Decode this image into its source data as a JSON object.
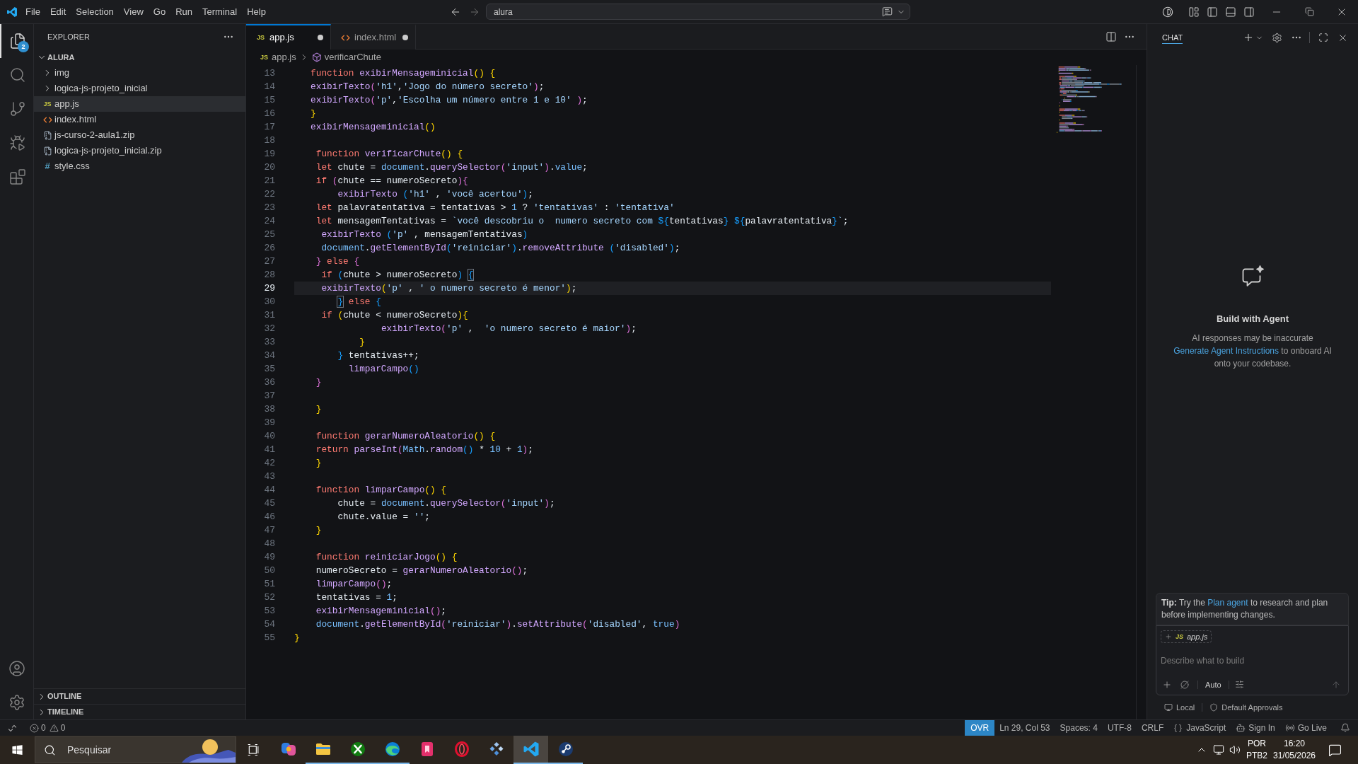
{
  "title_bar": {
    "menu": [
      "File",
      "Edit",
      "Selection",
      "View",
      "Go",
      "Run",
      "Terminal",
      "Help"
    ],
    "command_center": {
      "value": "alura"
    }
  },
  "activity_bar": {
    "items": [
      {
        "kind": "explorer",
        "selected": true,
        "badge": "2"
      },
      {
        "kind": "search",
        "selected": false
      },
      {
        "kind": "source_control",
        "selected": false
      },
      {
        "kind": "run",
        "selected": false
      },
      {
        "kind": "extensions",
        "selected": false
      }
    ],
    "bottom_items": [
      {
        "kind": "accounts"
      },
      {
        "kind": "manage"
      }
    ]
  },
  "explorer": {
    "title": "EXPLORER",
    "folder": {
      "name": "ALURA",
      "expanded": true,
      "children": [
        {
          "name": "img",
          "kind": "folder",
          "expanded": false,
          "selected": false
        },
        {
          "name": "logica-js-projeto_inicial",
          "kind": "folder",
          "expanded": false,
          "selected": false
        },
        {
          "name": "app.js",
          "kind": "js",
          "badge": "JS",
          "selected": true
        },
        {
          "name": "index.html",
          "kind": "html",
          "selected": false
        },
        {
          "name": "js-curso-2-aula1.zip",
          "kind": "zip",
          "selected": false
        },
        {
          "name": "logica-js-projeto_inicial.zip",
          "kind": "zip",
          "selected": false
        },
        {
          "name": "style.css",
          "kind": "css",
          "badge": "#",
          "selected": false
        }
      ]
    },
    "sections": [
      {
        "title": "OUTLINE",
        "expanded": false
      },
      {
        "title": "TIMELINE",
        "expanded": false
      }
    ]
  },
  "editor": {
    "tabs": [
      {
        "label": "app.js",
        "kind": "js",
        "badge": "JS",
        "selected": true,
        "modified": true
      },
      {
        "label": "index.html",
        "kind": "html",
        "selected": false,
        "modified": true
      }
    ],
    "breadcrumb": [
      {
        "label": "app.js",
        "kind": "js",
        "badge": "JS"
      },
      {
        "label": "verificarChute",
        "kind": "symbol"
      }
    ],
    "lines": [
      {
        "number": "13",
        "current": false,
        "tokens": [
          {
            "text": "   function ",
            "kind": "keyword"
          },
          {
            "text": "exibirMensageminicial",
            "kind": "function"
          },
          {
            "text": "() {",
            "kind": "bracket1"
          }
        ]
      },
      {
        "number": "14",
        "current": false,
        "tokens": [
          {
            "text": "   exibirTexto",
            "kind": "function"
          },
          {
            "text": "(",
            "kind": "bracket2"
          },
          {
            "text": "'h1'",
            "kind": "string"
          },
          {
            "text": ",",
            "kind": "plain"
          },
          {
            "text": "'Jogo do número secreto'",
            "kind": "string"
          },
          {
            "text": ")",
            "kind": "bracket2"
          },
          {
            "text": ";",
            "kind": "plain"
          }
        ]
      },
      {
        "number": "15",
        "current": false,
        "tokens": [
          {
            "text": "   exibirTexto",
            "kind": "function"
          },
          {
            "text": "(",
            "kind": "bracket2"
          },
          {
            "text": "'p'",
            "kind": "string"
          },
          {
            "text": ",",
            "kind": "plain"
          },
          {
            "text": "'Escolha um número entre 1 e 10'",
            "kind": "string"
          },
          {
            "text": " )",
            "kind": "bracket2"
          },
          {
            "text": ";",
            "kind": "plain"
          }
        ]
      },
      {
        "number": "16",
        "current": false,
        "tokens": [
          {
            "text": "   }",
            "kind": "bracket1"
          }
        ]
      },
      {
        "number": "17",
        "current": false,
        "tokens": [
          {
            "text": "   exibirMensageminicial",
            "kind": "function"
          },
          {
            "text": "()",
            "kind": "bracket1"
          }
        ]
      },
      {
        "number": "18",
        "current": false
      },
      {
        "number": "19",
        "current": false,
        "tokens": [
          {
            "text": "    function ",
            "kind": "keyword"
          },
          {
            "text": "verificarChute",
            "kind": "function"
          },
          {
            "text": "() {",
            "kind": "bracket1"
          }
        ]
      },
      {
        "number": "20",
        "current": false,
        "tokens": [
          {
            "text": "    let",
            "kind": "keyword"
          },
          {
            "text": " chute = ",
            "kind": "plain"
          },
          {
            "text": "document",
            "kind": "constant"
          },
          {
            "text": ".",
            "kind": "plain"
          },
          {
            "text": "querySelector",
            "kind": "function"
          },
          {
            "text": "(",
            "kind": "bracket2"
          },
          {
            "text": "'input'",
            "kind": "string"
          },
          {
            "text": ")",
            "kind": "bracket2"
          },
          {
            "text": ".",
            "kind": "plain"
          },
          {
            "text": "value",
            "kind": "constant"
          },
          {
            "text": ";",
            "kind": "plain"
          }
        ]
      },
      {
        "number": "21",
        "current": false,
        "tokens": [
          {
            "text": "    if ",
            "kind": "keyword"
          },
          {
            "text": "(",
            "kind": "bracket2"
          },
          {
            "text": "chute == numeroSecreto",
            "kind": "plain"
          },
          {
            "text": "){",
            "kind": "bracket2"
          }
        ]
      },
      {
        "number": "22",
        "current": false,
        "tokens": [
          {
            "text": "        exibirTexto ",
            "kind": "function"
          },
          {
            "text": "(",
            "kind": "bracket3"
          },
          {
            "text": "'h1'",
            "kind": "string"
          },
          {
            "text": " , ",
            "kind": "plain"
          },
          {
            "text": "'você acertou'",
            "kind": "string"
          },
          {
            "text": ")",
            "kind": "bracket3"
          },
          {
            "text": ";",
            "kind": "plain"
          }
        ]
      },
      {
        "number": "23",
        "current": false,
        "tokens": [
          {
            "text": "    let",
            "kind": "keyword"
          },
          {
            "text": " palavratentativa = tentativas > ",
            "kind": "plain"
          },
          {
            "text": "1",
            "kind": "constant"
          },
          {
            "text": " ? ",
            "kind": "plain"
          },
          {
            "text": "'tentativas'",
            "kind": "string"
          },
          {
            "text": " : ",
            "kind": "plain"
          },
          {
            "text": "'tentativa'",
            "kind": "string"
          }
        ]
      },
      {
        "number": "24",
        "current": false,
        "tokens": [
          {
            "text": "    let",
            "kind": "keyword"
          },
          {
            "text": " mensagemTentativas = ",
            "kind": "plain"
          },
          {
            "text": "`você descobriu o  numero secreto com ",
            "kind": "string"
          },
          {
            "text": "${",
            "kind": "bracket3"
          },
          {
            "text": "tentativas",
            "kind": "plain"
          },
          {
            "text": "} ${",
            "kind": "bracket3"
          },
          {
            "text": "palavratentativa",
            "kind": "plain"
          },
          {
            "text": "}",
            "kind": "bracket3"
          },
          {
            "text": "`",
            "kind": "string"
          },
          {
            "text": ";",
            "kind": "plain"
          }
        ]
      },
      {
        "number": "25",
        "current": false,
        "tokens": [
          {
            "text": "     exibirTexto ",
            "kind": "function"
          },
          {
            "text": "(",
            "kind": "bracket3"
          },
          {
            "text": "'p'",
            "kind": "string"
          },
          {
            "text": " , mensagemTentativas",
            "kind": "plain"
          },
          {
            "text": ")",
            "kind": "bracket3"
          }
        ]
      },
      {
        "number": "26",
        "current": false,
        "tokens": [
          {
            "text": "     document",
            "kind": "constant"
          },
          {
            "text": ".",
            "kind": "plain"
          },
          {
            "text": "getElementById",
            "kind": "function"
          },
          {
            "text": "(",
            "kind": "bracket3"
          },
          {
            "text": "'reiniciar'",
            "kind": "string"
          },
          {
            "text": ")",
            "kind": "bracket3"
          },
          {
            "text": ".",
            "kind": "plain"
          },
          {
            "text": "removeAttribute ",
            "kind": "function"
          },
          {
            "text": "(",
            "kind": "bracket3"
          },
          {
            "text": "'disabled'",
            "kind": "string"
          },
          {
            "text": ")",
            "kind": "bracket3"
          },
          {
            "text": ";",
            "kind": "plain"
          }
        ]
      },
      {
        "number": "27",
        "current": false,
        "tokens": [
          {
            "text": "    }",
            "kind": "bracket2"
          },
          {
            "text": " else ",
            "kind": "keyword"
          },
          {
            "text": "{",
            "kind": "bracket2"
          }
        ]
      },
      {
        "number": "28",
        "current": false,
        "tokens": [
          {
            "text": "     if ",
            "kind": "keyword"
          },
          {
            "text": "(",
            "kind": "bracket3"
          },
          {
            "text": "chute > numeroSecreto",
            "kind": "plain"
          },
          {
            "text": ") ",
            "kind": "bracket3"
          },
          {
            "text": "{",
            "kind": "match"
          }
        ]
      },
      {
        "number": "29",
        "current": true,
        "tokens": [
          {
            "text": "     exibirTexto",
            "kind": "function"
          },
          {
            "text": "(",
            "kind": "bracket1"
          },
          {
            "text": "'p'",
            "kind": "string"
          },
          {
            "text": " , ",
            "kind": "plain"
          },
          {
            "text": "' o numero secreto é menor'",
            "kind": "string"
          },
          {
            "text": ")",
            "kind": "bracket1"
          },
          {
            "text": ";",
            "kind": "plain"
          }
        ]
      },
      {
        "number": "30",
        "current": false,
        "tokens": [
          {
            "text": "        }",
            "kind": "match"
          },
          {
            "text": " else ",
            "kind": "keyword"
          },
          {
            "text": "{",
            "kind": "bracket3"
          }
        ]
      },
      {
        "number": "31",
        "current": false,
        "tokens": [
          {
            "text": "     if ",
            "kind": "keyword"
          },
          {
            "text": "(",
            "kind": "bracket1"
          },
          {
            "text": "chute < numeroSecreto",
            "kind": "plain"
          },
          {
            "text": "){",
            "kind": "bracket1"
          }
        ]
      },
      {
        "number": "32",
        "current": false,
        "tokens": [
          {
            "text": "                exibirTexto",
            "kind": "function"
          },
          {
            "text": "(",
            "kind": "bracket2"
          },
          {
            "text": "'p'",
            "kind": "string"
          },
          {
            "text": " ,  ",
            "kind": "plain"
          },
          {
            "text": "'o numero secreto é maior'",
            "kind": "string"
          },
          {
            "text": ")",
            "kind": "bracket2"
          },
          {
            "text": ";",
            "kind": "plain"
          }
        ]
      },
      {
        "number": "33",
        "current": false,
        "tokens": [
          {
            "text": "            }",
            "kind": "bracket1"
          }
        ]
      },
      {
        "number": "34",
        "current": false,
        "tokens": [
          {
            "text": "        }",
            "kind": "bracket3"
          },
          {
            "text": " tentativas++;",
            "kind": "plain"
          }
        ]
      },
      {
        "number": "35",
        "current": false,
        "tokens": [
          {
            "text": "          limparCampo",
            "kind": "function"
          },
          {
            "text": "()",
            "kind": "bracket3"
          }
        ]
      },
      {
        "number": "36",
        "current": false,
        "tokens": [
          {
            "text": "    }",
            "kind": "bracket2"
          }
        ]
      },
      {
        "number": "37",
        "current": false
      },
      {
        "number": "38",
        "current": false,
        "tokens": [
          {
            "text": "    }",
            "kind": "bracket1"
          }
        ]
      },
      {
        "number": "39",
        "current": false
      },
      {
        "number": "40",
        "current": false,
        "tokens": [
          {
            "text": "    function ",
            "kind": "keyword"
          },
          {
            "text": "gerarNumeroAleatorio",
            "kind": "function"
          },
          {
            "text": "() {",
            "kind": "bracket1"
          }
        ]
      },
      {
        "number": "41",
        "current": false,
        "tokens": [
          {
            "text": "    return ",
            "kind": "keyword"
          },
          {
            "text": "parseInt",
            "kind": "function"
          },
          {
            "text": "(",
            "kind": "bracket2"
          },
          {
            "text": "Math",
            "kind": "constant"
          },
          {
            "text": ".",
            "kind": "plain"
          },
          {
            "text": "random",
            "kind": "function"
          },
          {
            "text": "()",
            "kind": "bracket3"
          },
          {
            "text": " * ",
            "kind": "plain"
          },
          {
            "text": "10",
            "kind": "constant"
          },
          {
            "text": " + ",
            "kind": "plain"
          },
          {
            "text": "1",
            "kind": "constant"
          },
          {
            "text": ")",
            "kind": "bracket2"
          },
          {
            "text": ";",
            "kind": "plain"
          }
        ]
      },
      {
        "number": "42",
        "current": false,
        "tokens": [
          {
            "text": "    }",
            "kind": "bracket1"
          }
        ]
      },
      {
        "number": "43",
        "current": false
      },
      {
        "number": "44",
        "current": false,
        "tokens": [
          {
            "text": "    function ",
            "kind": "keyword"
          },
          {
            "text": "limparCampo",
            "kind": "function"
          },
          {
            "text": "() {",
            "kind": "bracket1"
          }
        ]
      },
      {
        "number": "45",
        "current": false,
        "tokens": [
          {
            "text": "        chute = ",
            "kind": "plain"
          },
          {
            "text": "document",
            "kind": "constant"
          },
          {
            "text": ".",
            "kind": "plain"
          },
          {
            "text": "querySelector",
            "kind": "function"
          },
          {
            "text": "(",
            "kind": "bracket2"
          },
          {
            "text": "'input'",
            "kind": "string"
          },
          {
            "text": ")",
            "kind": "bracket2"
          },
          {
            "text": ";",
            "kind": "plain"
          }
        ]
      },
      {
        "number": "46",
        "current": false,
        "tokens": [
          {
            "text": "        chute.value = ",
            "kind": "plain"
          },
          {
            "text": "''",
            "kind": "string"
          },
          {
            "text": ";",
            "kind": "plain"
          }
        ]
      },
      {
        "number": "47",
        "current": false,
        "tokens": [
          {
            "text": "    }",
            "kind": "bracket1"
          }
        ]
      },
      {
        "number": "48",
        "current": false
      },
      {
        "number": "49",
        "current": false,
        "tokens": [
          {
            "text": "    function ",
            "kind": "keyword"
          },
          {
            "text": "reiniciarJogo",
            "kind": "function"
          },
          {
            "text": "() {",
            "kind": "bracket1"
          }
        ]
      },
      {
        "number": "50",
        "current": false,
        "tokens": [
          {
            "text": "    numeroSecreto = ",
            "kind": "plain"
          },
          {
            "text": "gerarNumeroAleatorio",
            "kind": "function"
          },
          {
            "text": "()",
            "kind": "bracket2"
          },
          {
            "text": ";",
            "kind": "plain"
          }
        ]
      },
      {
        "number": "51",
        "current": false,
        "tokens": [
          {
            "text": "    limparCampo",
            "kind": "function"
          },
          {
            "text": "()",
            "kind": "bracket2"
          },
          {
            "text": ";",
            "kind": "plain"
          }
        ]
      },
      {
        "number": "52",
        "current": false,
        "tokens": [
          {
            "text": "    tentativas = ",
            "kind": "plain"
          },
          {
            "text": "1",
            "kind": "constant"
          },
          {
            "text": ";",
            "kind": "plain"
          }
        ]
      },
      {
        "number": "53",
        "current": false,
        "tokens": [
          {
            "text": "    exibirMensageminicial",
            "kind": "function"
          },
          {
            "text": "()",
            "kind": "bracket2"
          },
          {
            "text": ";",
            "kind": "plain"
          }
        ]
      },
      {
        "number": "54",
        "current": false,
        "tokens": [
          {
            "text": "    document",
            "kind": "constant"
          },
          {
            "text": ".",
            "kind": "plain"
          },
          {
            "text": "getElementById",
            "kind": "function"
          },
          {
            "text": "(",
            "kind": "bracket2"
          },
          {
            "text": "'reiniciar'",
            "kind": "string"
          },
          {
            "text": ")",
            "kind": "bracket2"
          },
          {
            "text": ".",
            "kind": "plain"
          },
          {
            "text": "setAttribute",
            "kind": "function"
          },
          {
            "text": "(",
            "kind": "bracket2"
          },
          {
            "text": "'disabled'",
            "kind": "string"
          },
          {
            "text": ", ",
            "kind": "plain"
          },
          {
            "text": "true",
            "kind": "constant"
          },
          {
            "text": ")",
            "kind": "bracket2"
          }
        ]
      },
      {
        "number": "55",
        "current": false,
        "tokens": [
          {
            "text": "}",
            "kind": "bracket1"
          }
        ]
      }
    ]
  },
  "chat": {
    "title": "CHAT",
    "heading": "Build with Agent",
    "note": "AI responses may be inaccurate",
    "instructions": {
      "link": "Generate Agent Instructions",
      "text": "to onboard AI onto your codebase."
    },
    "tip": {
      "label": "Tip:",
      "before": "Try the",
      "link": "Plan agent",
      "after": "to research and plan before implementing changes."
    },
    "composer": {
      "attachment": {
        "kind": "js",
        "badge": "JS",
        "label": "app.js"
      },
      "placeholder": "Describe what to build",
      "mode": "Auto"
    },
    "footer": [
      {
        "kind": "location",
        "label": "Local"
      },
      {
        "kind": "approvals",
        "label": "Default Approvals"
      }
    ]
  },
  "status_bar": {
    "problems": {
      "errors": "0",
      "warnings": "0"
    },
    "items": [
      {
        "kind": "mode",
        "text": "OVR"
      },
      {
        "kind": "text",
        "text": "Ln 29, Col 53"
      },
      {
        "kind": "text",
        "text": "Spaces: 4"
      },
      {
        "kind": "text",
        "text": "UTF-8"
      },
      {
        "kind": "text",
        "text": "CRLF"
      },
      {
        "kind": "language",
        "text": "JavaScript"
      },
      {
        "kind": "account",
        "text": "Sign In"
      },
      {
        "kind": "live",
        "text": "Go Live"
      }
    ]
  },
  "taskbar": {
    "search": {
      "placeholder": "Pesquisar"
    },
    "apps": [
      {
        "kind": "swirl",
        "running": false,
        "selected": false
      },
      {
        "kind": "folder",
        "running": true,
        "selected": false
      },
      {
        "kind": "cross",
        "running": true,
        "selected": false
      },
      {
        "kind": "wave",
        "running": true,
        "selected": false
      },
      {
        "kind": "tile",
        "running": false,
        "selected": false
      },
      {
        "kind": "ring",
        "running": false,
        "selected": false
      },
      {
        "kind": "shapes",
        "running": false,
        "selected": false
      },
      {
        "kind": "ribbon",
        "running": true,
        "selected": true
      },
      {
        "kind": "piston",
        "running": true,
        "selected": false
      }
    ],
    "tray": {
      "language": "POR",
      "layout": "PTB2",
      "time": "16:20",
      "date": "31/05/2026"
    }
  }
}
